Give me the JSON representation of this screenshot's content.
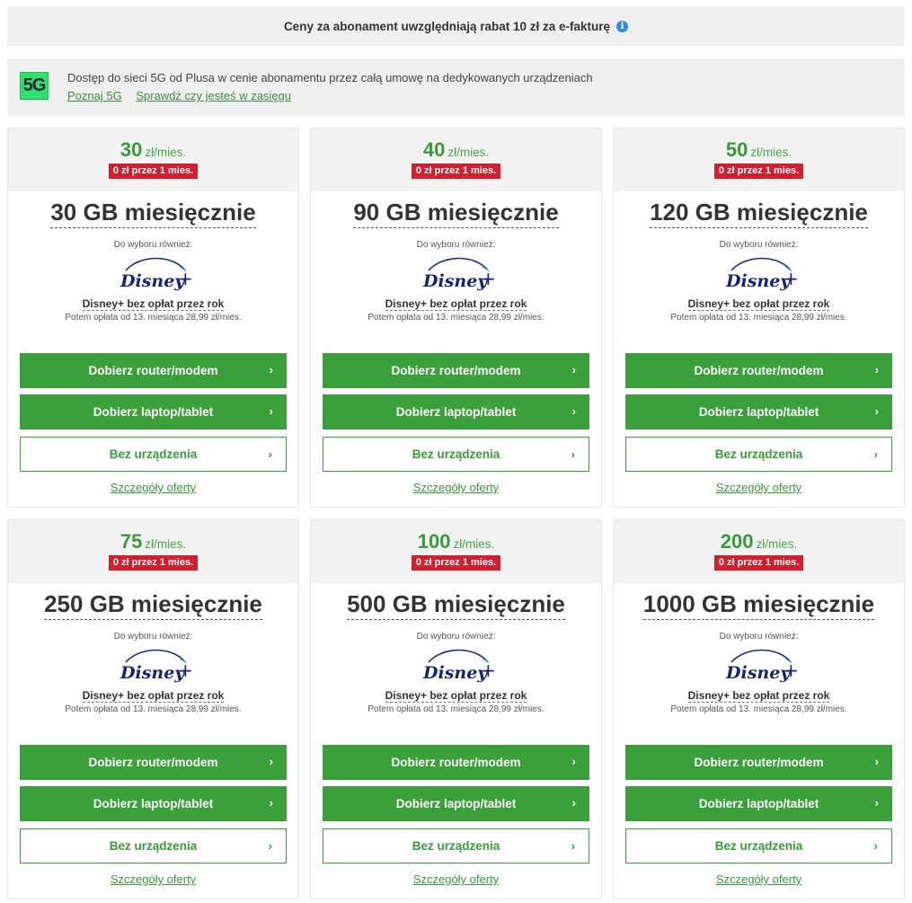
{
  "topbar": {
    "text": "Ceny za abonament uwzględniają rabat 10 zł za e-fakturę",
    "info_icon": "i"
  },
  "banner": {
    "badge": "5G",
    "text": "Dostęp do sieci 5G od Plusa w cenie abonamentu przez całą umowę na dedykowanych urządzeniach",
    "link1": "Poznaj 5G",
    "link2": "Sprawdź czy jesteś w zasięgu"
  },
  "colors": {
    "accent": "#3aa03a",
    "promo": "#d21f2d",
    "badge5g": "#2ee06f"
  },
  "plans": [
    {
      "price": "30",
      "unit": "zł/mies.",
      "promo": "0 zł przez 1 mies.",
      "gb": "30 GB miesięcznie",
      "choose": "Do wyboru również:",
      "disney_title": "Disney+ bez opłat przez rok",
      "disney_sub": "Potem opłata od 13. miesiąca 28,99 zł/mies.",
      "btn_router": "Dobierz router/modem",
      "btn_laptop": "Dobierz laptop/tablet",
      "btn_none": "Bez urządzenia",
      "details": "Szczegóły oferty"
    },
    {
      "price": "40",
      "unit": "zł/mies.",
      "promo": "0 zł przez 1 mies.",
      "gb": "90 GB miesięcznie",
      "choose": "Do wyboru również:",
      "disney_title": "Disney+ bez opłat przez rok",
      "disney_sub": "Potem opłata od 13. miesiąca 28,99 zł/mies.",
      "btn_router": "Dobierz router/modem",
      "btn_laptop": "Dobierz laptop/tablet",
      "btn_none": "Bez urządzenia",
      "details": "Szczegóły oferty"
    },
    {
      "price": "50",
      "unit": "zł/mies.",
      "promo": "0 zł przez 1 mies.",
      "gb": "120 GB miesięcznie",
      "choose": "Do wyboru również:",
      "disney_title": "Disney+ bez opłat przez rok",
      "disney_sub": "Potem opłata od 13. miesiąca 28,99 zł/mies.",
      "btn_router": "Dobierz router/modem",
      "btn_laptop": "Dobierz laptop/tablet",
      "btn_none": "Bez urządzenia",
      "details": "Szczegóły oferty"
    },
    {
      "price": "75",
      "unit": "zł/mies.",
      "promo": "0 zł przez 1 mies.",
      "gb": "250 GB miesięcznie",
      "choose": "Do wyboru również:",
      "disney_title": "Disney+ bez opłat przez rok",
      "disney_sub": "Potem opłata od 13. miesiąca 28,99 zł/mies.",
      "btn_router": "Dobierz router/modem",
      "btn_laptop": "Dobierz laptop/tablet",
      "btn_none": "Bez urządzenia",
      "details": "Szczegóły oferty"
    },
    {
      "price": "100",
      "unit": "zł/mies.",
      "promo": "0 zł przez 1 mies.",
      "gb": "500 GB miesięcznie",
      "choose": "Do wyboru również:",
      "disney_title": "Disney+ bez opłat przez rok",
      "disney_sub": "Potem opłata od 13. miesiąca 28,99 zł/mies.",
      "btn_router": "Dobierz router/modem",
      "btn_laptop": "Dobierz laptop/tablet",
      "btn_none": "Bez urządzenia",
      "details": "Szczegóły oferty"
    },
    {
      "price": "200",
      "unit": "zł/mies.",
      "promo": "0 zł przez 1 mies.",
      "gb": "1000 GB miesięcznie",
      "choose": "Do wyboru również:",
      "disney_title": "Disney+ bez opłat przez rok",
      "disney_sub": "Potem opłata od 13. miesiąca 28,99 zł/mies.",
      "btn_router": "Dobierz router/modem",
      "btn_laptop": "Dobierz laptop/tablet",
      "btn_none": "Bez urządzenia",
      "details": "Szczegóły oferty"
    }
  ]
}
